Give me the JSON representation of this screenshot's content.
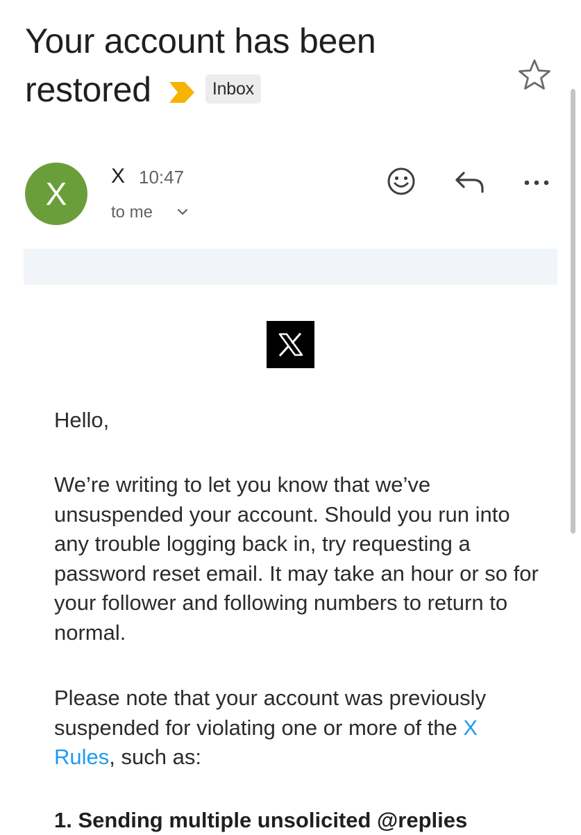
{
  "email": {
    "subject": "Your account has been restored",
    "label": "Inbox",
    "importance_color": "#f4b400",
    "sender": {
      "avatar_letter": "X",
      "avatar_color": "#6a9e3b",
      "name": "X",
      "time": "10:47",
      "recipient": "to me"
    },
    "actions": {
      "emoji_icon": "smiley-icon",
      "reply_icon": "reply-arrow-icon",
      "more_icon": "more-horizontal-icon",
      "star_icon": "star-outline-icon"
    }
  },
  "message": {
    "logo_icon": "x-logo-icon",
    "greeting": "Hello,",
    "paragraph1": "We’re writing to let you know that we’ve unsuspended your account. Should you run into any trouble logging back in, try requesting a password reset email. It may take an hour or so for your follower and following numbers to return to normal.",
    "paragraph2_before": "Please note that your account was previously suspended for violating one or more of the ",
    "paragraph2_link": "X Rules",
    "paragraph2_after": ", such as:",
    "list_item_1": "1. Sending multiple unsolicited @replies",
    "link_color": "#1d9bf0"
  }
}
